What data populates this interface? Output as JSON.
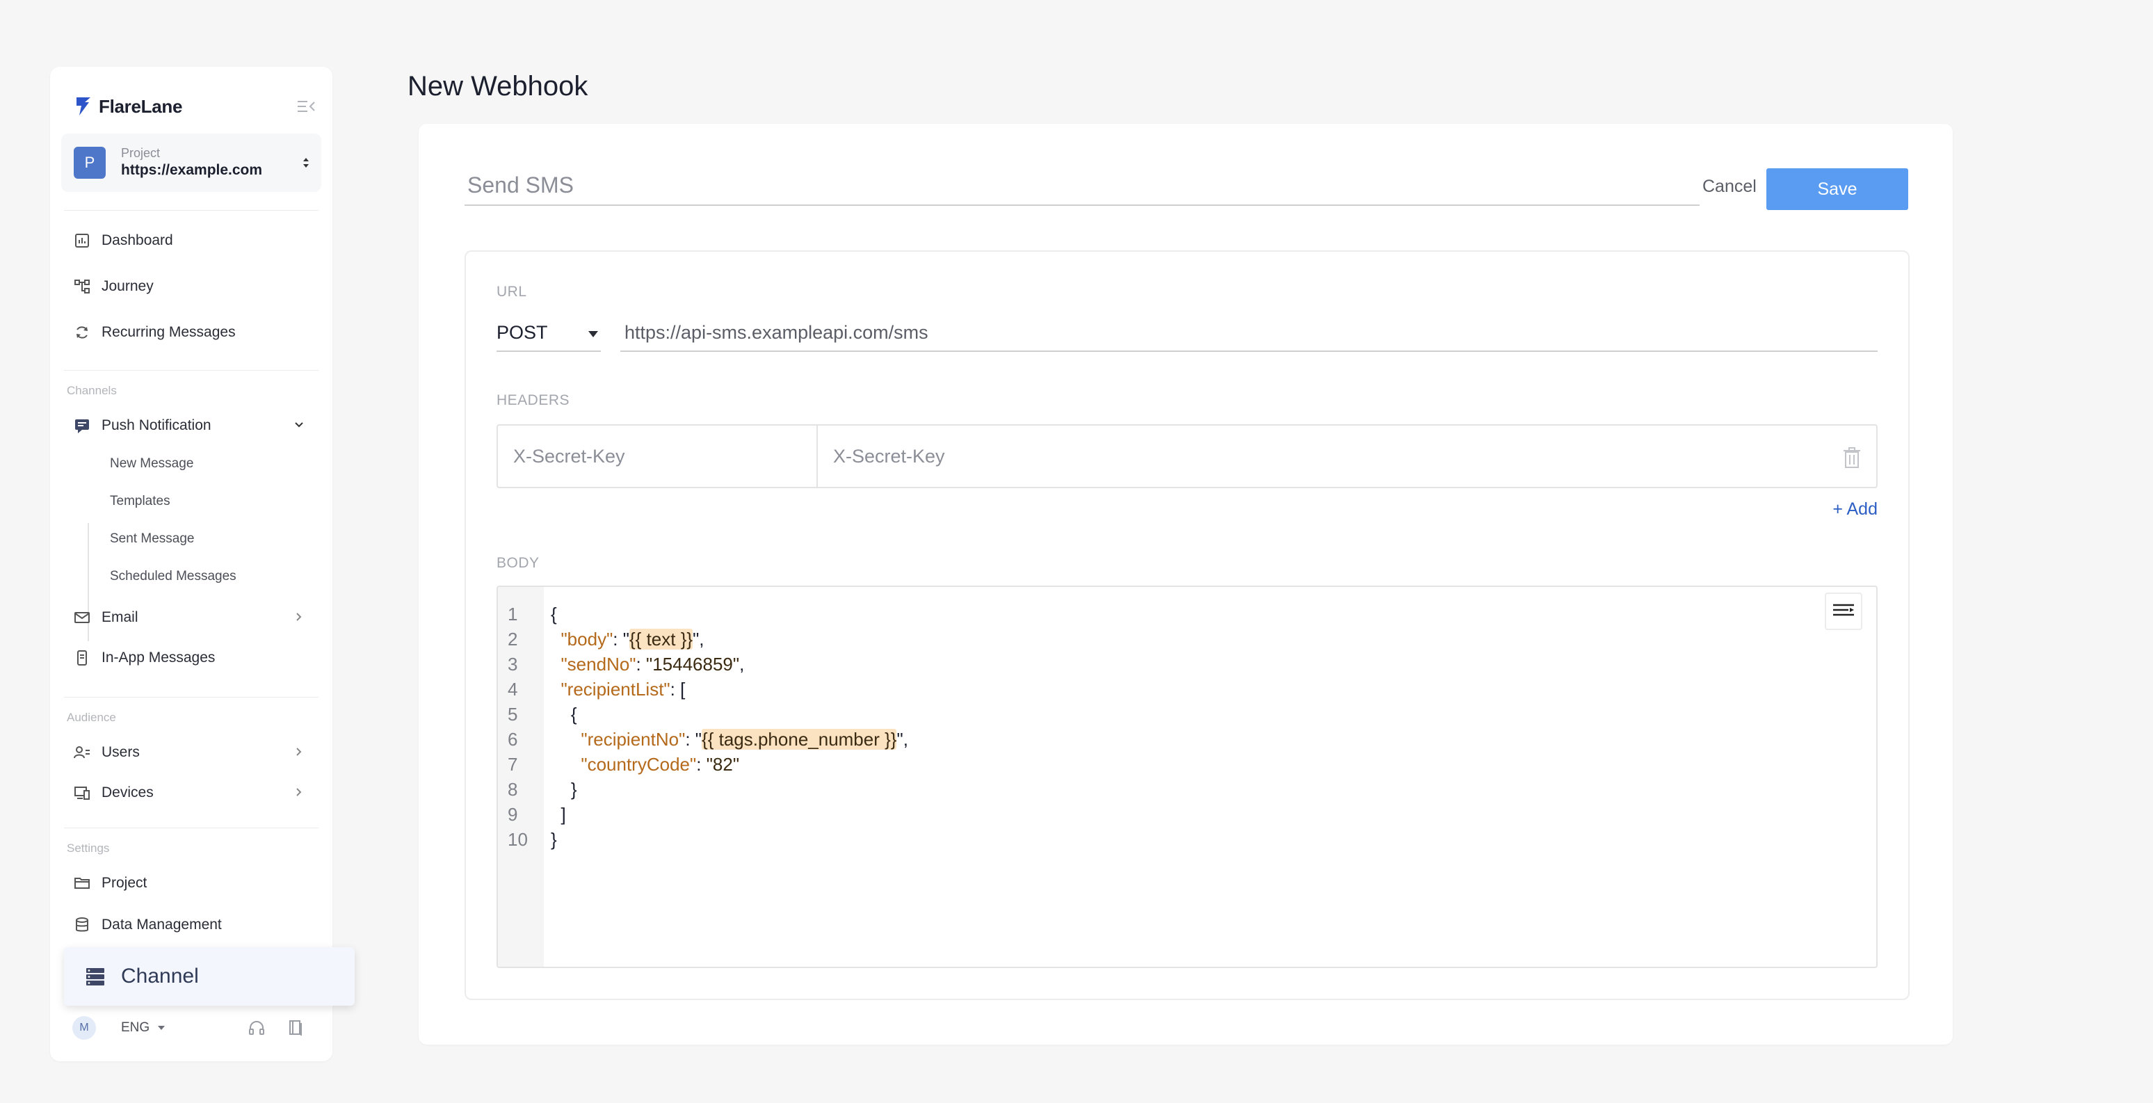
{
  "sidebar": {
    "brand": "FlareLane",
    "project": {
      "avatar": "P",
      "caption": "Project",
      "url": "https://example.com"
    },
    "top_nav": [
      {
        "label": "Dashboard",
        "icon": "chart-icon"
      },
      {
        "label": "Journey",
        "icon": "flow-icon"
      },
      {
        "label": "Recurring Messages",
        "icon": "refresh-icon"
      }
    ],
    "channels_label": "Channels",
    "channels": {
      "push": {
        "label": "Push Notification",
        "sub": [
          "New Message",
          "Templates",
          "Sent Message",
          "Scheduled Messages"
        ]
      },
      "email": "Email",
      "inapp": "In-App Messages"
    },
    "audience_label": "Audience",
    "audience": [
      "Users",
      "Devices"
    ],
    "settings_label": "Settings",
    "settings": [
      "Project",
      "Data Management"
    ],
    "tooltip": "Channel",
    "footer": {
      "avatar": "M",
      "lang": "ENG"
    }
  },
  "page": {
    "title": "New Webhook",
    "name_placeholder": "Send SMS",
    "cancel": "Cancel",
    "save": "Save",
    "url_label": "URL",
    "method": "POST",
    "url": "https://api-sms.exampleapi.com/sms",
    "headers_label": "HEADERS",
    "header_key": "X-Secret-Key",
    "header_value": "X-Secret-Key",
    "add": "+ Add",
    "body_label": "BODY",
    "body_lines": [
      "1",
      "2",
      "3",
      "4",
      "5",
      "6",
      "7",
      "8",
      "9",
      "10"
    ],
    "body": {
      "body_key": "\"body\"",
      "body_val": "{{ text }}",
      "send_key": "\"sendNo\"",
      "send_val": "\"15446859\"",
      "list_key": "\"recipientList\"",
      "rec_key": "\"recipientNo\"",
      "rec_val": "{{ tags.phone_number }}",
      "cc_key": "\"countryCode\"",
      "cc_val": "\"82\""
    }
  },
  "colors": {
    "accent": "#5b9cf3",
    "brand": "#1b1f2e",
    "link": "#2c5ec4",
    "template_highlight": "#fbe3c2"
  }
}
